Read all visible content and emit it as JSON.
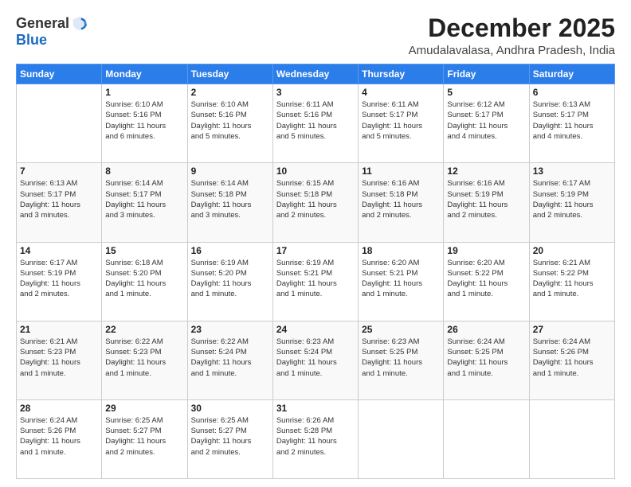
{
  "logo": {
    "general": "General",
    "blue": "Blue"
  },
  "header": {
    "month": "December 2025",
    "location": "Amudalavalasa, Andhra Pradesh, India"
  },
  "weekdays": [
    "Sunday",
    "Monday",
    "Tuesday",
    "Wednesday",
    "Thursday",
    "Friday",
    "Saturday"
  ],
  "weeks": [
    [
      {
        "day": "",
        "info": ""
      },
      {
        "day": "1",
        "info": "Sunrise: 6:10 AM\nSunset: 5:16 PM\nDaylight: 11 hours\nand 6 minutes."
      },
      {
        "day": "2",
        "info": "Sunrise: 6:10 AM\nSunset: 5:16 PM\nDaylight: 11 hours\nand 5 minutes."
      },
      {
        "day": "3",
        "info": "Sunrise: 6:11 AM\nSunset: 5:16 PM\nDaylight: 11 hours\nand 5 minutes."
      },
      {
        "day": "4",
        "info": "Sunrise: 6:11 AM\nSunset: 5:17 PM\nDaylight: 11 hours\nand 5 minutes."
      },
      {
        "day": "5",
        "info": "Sunrise: 6:12 AM\nSunset: 5:17 PM\nDaylight: 11 hours\nand 4 minutes."
      },
      {
        "day": "6",
        "info": "Sunrise: 6:13 AM\nSunset: 5:17 PM\nDaylight: 11 hours\nand 4 minutes."
      }
    ],
    [
      {
        "day": "7",
        "info": "Sunrise: 6:13 AM\nSunset: 5:17 PM\nDaylight: 11 hours\nand 3 minutes."
      },
      {
        "day": "8",
        "info": "Sunrise: 6:14 AM\nSunset: 5:17 PM\nDaylight: 11 hours\nand 3 minutes."
      },
      {
        "day": "9",
        "info": "Sunrise: 6:14 AM\nSunset: 5:18 PM\nDaylight: 11 hours\nand 3 minutes."
      },
      {
        "day": "10",
        "info": "Sunrise: 6:15 AM\nSunset: 5:18 PM\nDaylight: 11 hours\nand 2 minutes."
      },
      {
        "day": "11",
        "info": "Sunrise: 6:16 AM\nSunset: 5:18 PM\nDaylight: 11 hours\nand 2 minutes."
      },
      {
        "day": "12",
        "info": "Sunrise: 6:16 AM\nSunset: 5:19 PM\nDaylight: 11 hours\nand 2 minutes."
      },
      {
        "day": "13",
        "info": "Sunrise: 6:17 AM\nSunset: 5:19 PM\nDaylight: 11 hours\nand 2 minutes."
      }
    ],
    [
      {
        "day": "14",
        "info": "Sunrise: 6:17 AM\nSunset: 5:19 PM\nDaylight: 11 hours\nand 2 minutes."
      },
      {
        "day": "15",
        "info": "Sunrise: 6:18 AM\nSunset: 5:20 PM\nDaylight: 11 hours\nand 1 minute."
      },
      {
        "day": "16",
        "info": "Sunrise: 6:19 AM\nSunset: 5:20 PM\nDaylight: 11 hours\nand 1 minute."
      },
      {
        "day": "17",
        "info": "Sunrise: 6:19 AM\nSunset: 5:21 PM\nDaylight: 11 hours\nand 1 minute."
      },
      {
        "day": "18",
        "info": "Sunrise: 6:20 AM\nSunset: 5:21 PM\nDaylight: 11 hours\nand 1 minute."
      },
      {
        "day": "19",
        "info": "Sunrise: 6:20 AM\nSunset: 5:22 PM\nDaylight: 11 hours\nand 1 minute."
      },
      {
        "day": "20",
        "info": "Sunrise: 6:21 AM\nSunset: 5:22 PM\nDaylight: 11 hours\nand 1 minute."
      }
    ],
    [
      {
        "day": "21",
        "info": "Sunrise: 6:21 AM\nSunset: 5:23 PM\nDaylight: 11 hours\nand 1 minute."
      },
      {
        "day": "22",
        "info": "Sunrise: 6:22 AM\nSunset: 5:23 PM\nDaylight: 11 hours\nand 1 minute."
      },
      {
        "day": "23",
        "info": "Sunrise: 6:22 AM\nSunset: 5:24 PM\nDaylight: 11 hours\nand 1 minute."
      },
      {
        "day": "24",
        "info": "Sunrise: 6:23 AM\nSunset: 5:24 PM\nDaylight: 11 hours\nand 1 minute."
      },
      {
        "day": "25",
        "info": "Sunrise: 6:23 AM\nSunset: 5:25 PM\nDaylight: 11 hours\nand 1 minute."
      },
      {
        "day": "26",
        "info": "Sunrise: 6:24 AM\nSunset: 5:25 PM\nDaylight: 11 hours\nand 1 minute."
      },
      {
        "day": "27",
        "info": "Sunrise: 6:24 AM\nSunset: 5:26 PM\nDaylight: 11 hours\nand 1 minute."
      }
    ],
    [
      {
        "day": "28",
        "info": "Sunrise: 6:24 AM\nSunset: 5:26 PM\nDaylight: 11 hours\nand 1 minute."
      },
      {
        "day": "29",
        "info": "Sunrise: 6:25 AM\nSunset: 5:27 PM\nDaylight: 11 hours\nand 2 minutes."
      },
      {
        "day": "30",
        "info": "Sunrise: 6:25 AM\nSunset: 5:27 PM\nDaylight: 11 hours\nand 2 minutes."
      },
      {
        "day": "31",
        "info": "Sunrise: 6:26 AM\nSunset: 5:28 PM\nDaylight: 11 hours\nand 2 minutes."
      },
      {
        "day": "",
        "info": ""
      },
      {
        "day": "",
        "info": ""
      },
      {
        "day": "",
        "info": ""
      }
    ]
  ]
}
